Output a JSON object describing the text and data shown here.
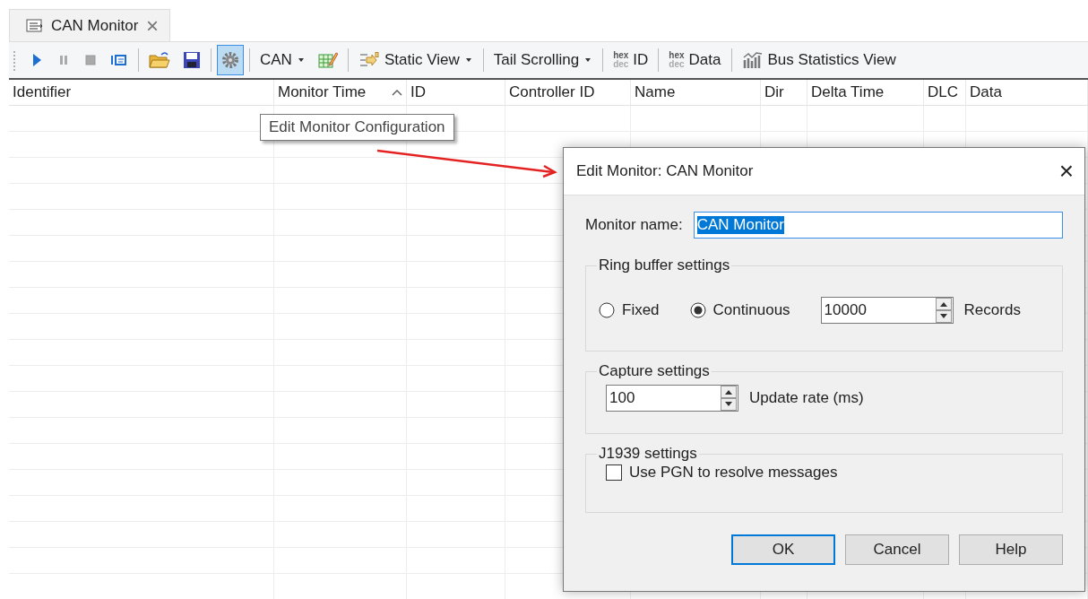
{
  "tab": {
    "title": "CAN Monitor",
    "close": "×"
  },
  "toolbar": [
    {
      "kind": "icon",
      "pressed": false
    },
    {
      "kind": "icon",
      "pressed": false
    },
    {
      "kind": "icon",
      "pressed": false
    },
    {
      "kind": "icon",
      "pressed": false
    },
    {
      "kind": "sep"
    },
    {
      "kind": "icon",
      "pressed": false
    },
    {
      "kind": "icon",
      "pressed": false
    },
    {
      "kind": "sep"
    },
    {
      "kind": "icon",
      "pressed": true
    },
    {
      "kind": "sep"
    },
    {
      "kind": "dropdown",
      "label": "CAN"
    },
    {
      "kind": "icon",
      "pressed": false
    },
    {
      "kind": "sep"
    },
    {
      "kind": "dropdown",
      "label": "Static View"
    },
    {
      "kind": "sep"
    },
    {
      "kind": "dropdown",
      "label": "Tail Scrolling"
    },
    {
      "kind": "sep"
    },
    {
      "kind": "hex",
      "top": "hex",
      "bottom": "dec",
      "label": "ID"
    },
    {
      "kind": "sep"
    },
    {
      "kind": "hex",
      "top": "hex",
      "bottom": "dec",
      "label": "Data"
    },
    {
      "kind": "sep"
    },
    {
      "kind": "button",
      "label": "Bus Statistics View"
    }
  ],
  "table": {
    "columns": [
      {
        "label": "Identifier",
        "sorted": false
      },
      {
        "label": "Monitor Time",
        "sorted": true
      },
      {
        "label": "ID",
        "sorted": false
      },
      {
        "label": "Controller ID",
        "sorted": false
      },
      {
        "label": "Name",
        "sorted": false
      },
      {
        "label": "Dir",
        "sorted": false
      },
      {
        "label": "Delta Time",
        "sorted": false
      },
      {
        "label": "DLC",
        "sorted": false
      },
      {
        "label": "Data",
        "sorted": false
      }
    ]
  },
  "tooltip": "Edit Monitor Configuration",
  "dialog": {
    "title": "Edit Monitor: CAN Monitor",
    "close": "×",
    "monitor_name": {
      "label": "Monitor name:",
      "value": "CAN Monitor",
      "selected": true
    },
    "ring_buffer": {
      "title": "Ring buffer settings",
      "options": [
        {
          "label": "Fixed",
          "selected": false
        },
        {
          "label": "Continuous",
          "selected": true
        }
      ],
      "value": "10000",
      "unit": "Records"
    },
    "capture": {
      "title": "Capture settings",
      "value": "100",
      "unit": "Update rate (ms)"
    },
    "j1939": {
      "title": "J1939 settings",
      "checkbox": {
        "label": "Use PGN to resolve messages",
        "checked": false
      }
    },
    "buttons": [
      {
        "label": "OK",
        "default": true
      },
      {
        "label": "Cancel",
        "default": false
      },
      {
        "label": "Help",
        "default": false
      }
    ]
  }
}
